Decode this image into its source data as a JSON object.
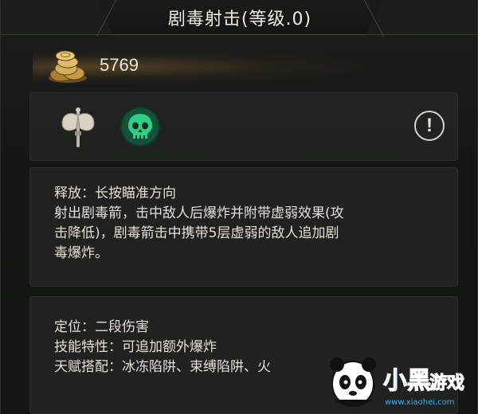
{
  "skill": {
    "title": "剧毒射击(等级.0)"
  },
  "currency": {
    "gold": "5769",
    "icon": "gold-coins-icon"
  },
  "icons": {
    "weapon": "battle-axe-icon",
    "element": "poison-skull-icon",
    "info": "!"
  },
  "description": {
    "cast_label": "释放：长按瞄准方向",
    "lines": [
      "射出剧毒箭，击中敌人后爆炸并附带虚弱效果(攻",
      "击降低)，剧毒箭击中携带5层虚弱的敌人追加剧",
      "毒爆炸。"
    ]
  },
  "info": {
    "role_label": "定位：二段伤害",
    "trait_line": "技能特性：可追加额外爆炸",
    "talent_line": "天赋搭配：冰冻陷阱、束缚陷阱、火"
  },
  "watermark": {
    "brand": "小黑游戏",
    "url": "www.xiaohei.com"
  },
  "colors": {
    "accent_green": "#8fd14a",
    "skull_green": "#2fcf86",
    "gold": "#c9a25a"
  }
}
